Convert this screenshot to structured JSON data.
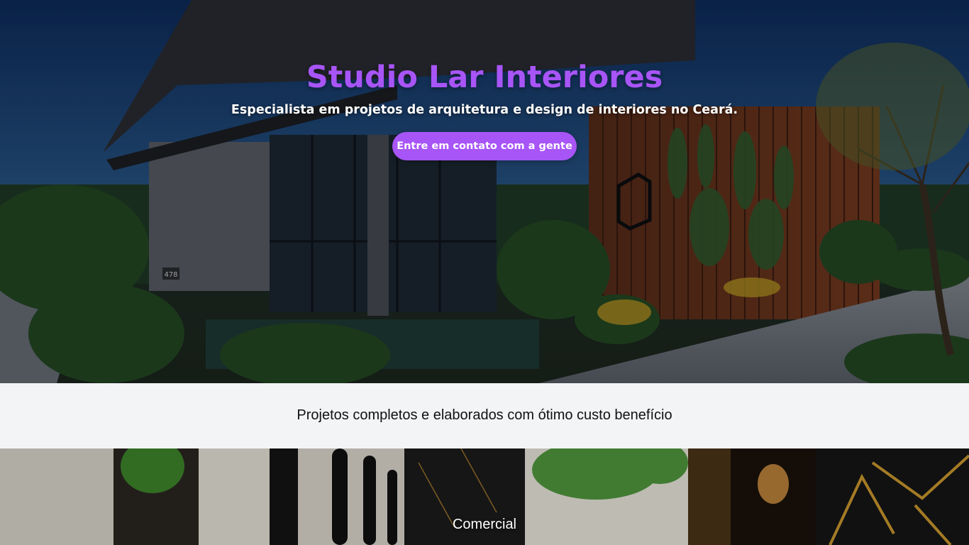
{
  "hero": {
    "title": "Studio Lar Interiores",
    "subtitle": "Especialista em projetos de arquitetura e design de interiores no Ceará.",
    "cta_label": "Entre em contato com a gente",
    "house_number": "478"
  },
  "tagline": {
    "text": "Projetos completos e elaborados com ótimo custo benefício"
  },
  "category": {
    "label": "Comercial"
  },
  "colors": {
    "accent": "#a855f7",
    "band_background": "#f3f4f6",
    "text_dark": "#111111",
    "text_light": "#ffffff"
  }
}
